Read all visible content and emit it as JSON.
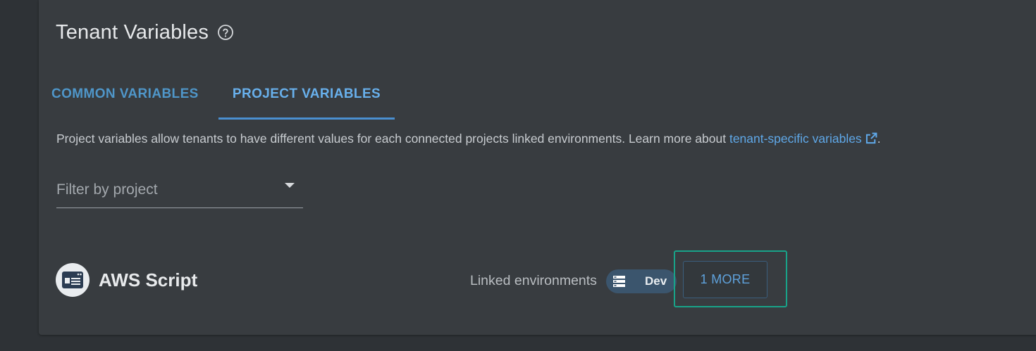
{
  "header": {
    "title": "Tenant Variables",
    "help_icon": "help-circle-icon"
  },
  "tabs": [
    {
      "label": "COMMON VARIABLES",
      "active": false
    },
    {
      "label": "PROJECT VARIABLES",
      "active": true
    }
  ],
  "description": {
    "text": "Project variables allow tenants to have different values for each connected projects linked environments. Learn more about ",
    "link_text": "tenant-specific variables",
    "link_icon": "external-link-icon",
    "suffix": "."
  },
  "filter": {
    "placeholder": "Filter by project",
    "value": ""
  },
  "project": {
    "name": "AWS Script",
    "icon": "script-window-icon",
    "linked_label": "Linked environments",
    "environment_chip": "Dev",
    "environment_icon": "environment-icon",
    "more_button": "1 MORE"
  },
  "colors": {
    "background": "#2e3236",
    "panel": "#383c40",
    "accent": "#68b0ec",
    "link": "#5fa8e8",
    "highlight": "#18a389",
    "chip": "#3b556d"
  }
}
